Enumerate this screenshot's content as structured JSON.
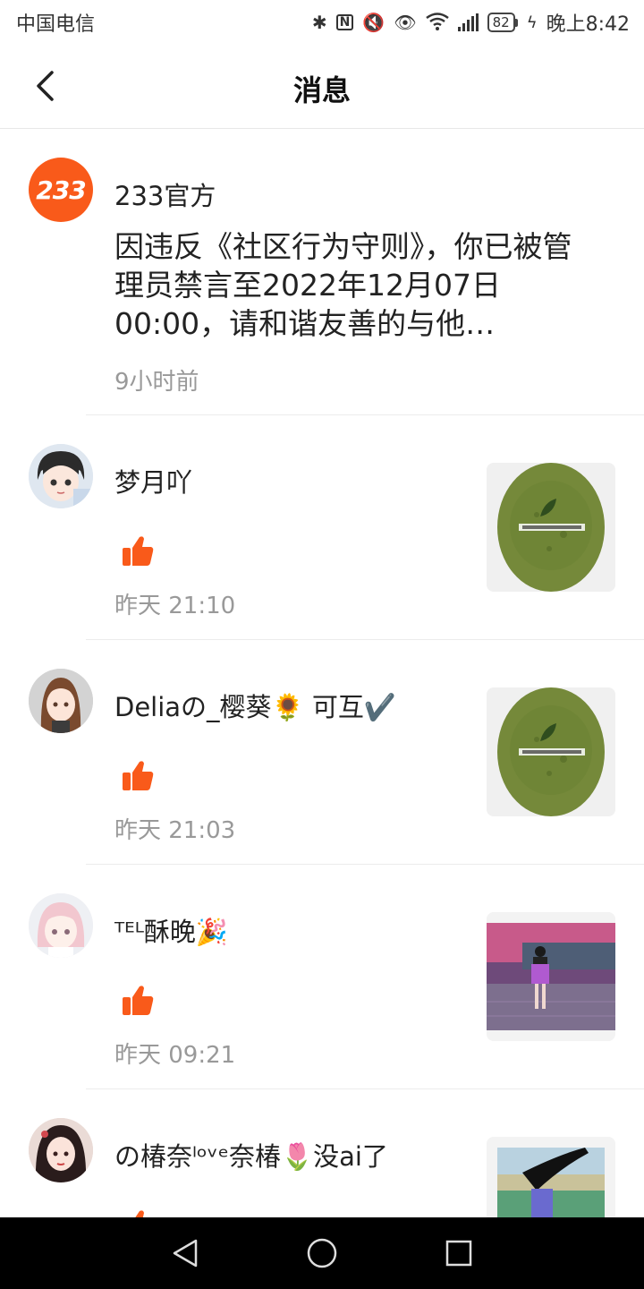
{
  "status_bar": {
    "carrier": "中国电信",
    "battery": "82",
    "time": "晚上8:42",
    "network": "4G"
  },
  "header": {
    "title": "消息",
    "back_icon": "back-chevron-icon"
  },
  "messages": [
    {
      "sender": "233官方",
      "avatar_text": "233",
      "body": "因违反《社区行为守则》，你已被管理员禁言至2022年12月07日 00:00，请和谐友善的与他…",
      "time": "9小时前"
    },
    {
      "sender": "梦月吖",
      "icon": "thumbs-up-icon",
      "time": "昨天 21:10",
      "thumbnail": "matcha-bowl"
    },
    {
      "sender": "Deliaの_樱葵🌻 可互✔️",
      "icon": "thumbs-up-icon",
      "time": "昨天 21:03",
      "thumbnail": "matcha-bowl"
    },
    {
      "sender": "ᵀᴱᴸ酥晚🎉",
      "icon": "thumbs-up-icon",
      "time": "昨天 09:21",
      "thumbnail": "game-character-scene"
    },
    {
      "sender": "の椿奈ˡᵒᵛᵉ奈椿🌷没ai了",
      "icon": "thumbs-up-icon",
      "time": "",
      "thumbnail": "game-school-scene"
    }
  ],
  "colors": {
    "accent": "#F95A1A",
    "time_gray": "#999999",
    "divider": "#ECECEC"
  }
}
